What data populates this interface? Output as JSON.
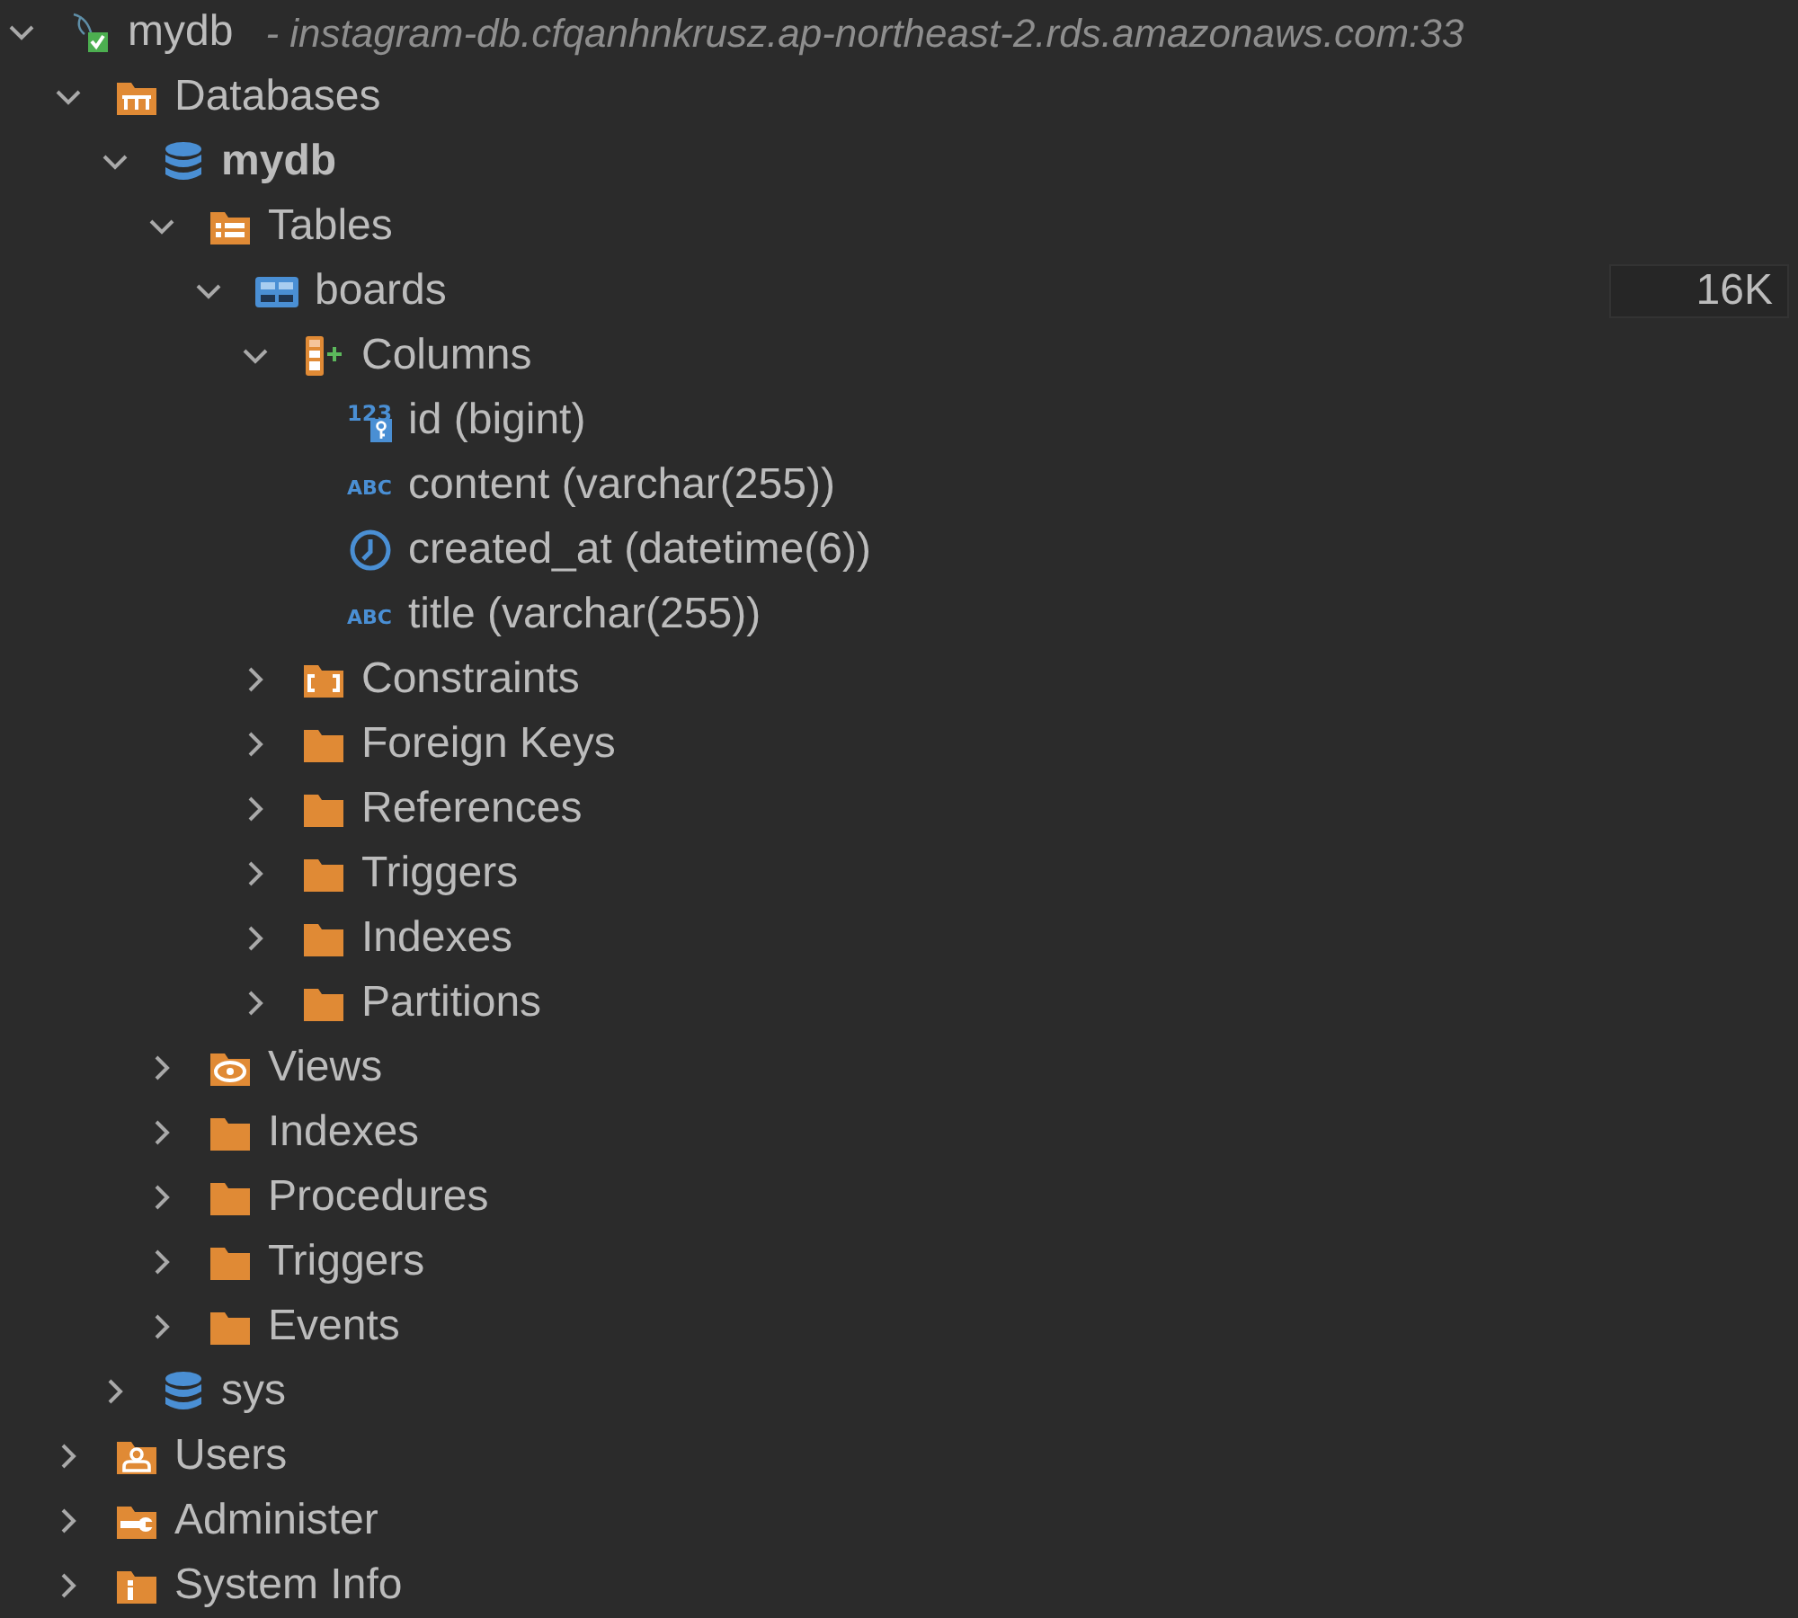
{
  "tree": [
    {
      "kind": "connection",
      "label": "mydb",
      "detail": "- instagram-db.cfqanhnkrusz.ap-northeast-2.rds.amazonaws.com:33",
      "expanded": true,
      "children": [
        {
          "kind": "databases",
          "label": "Databases",
          "expanded": true,
          "children": [
            {
              "kind": "database",
              "label": "mydb",
              "bold": true,
              "expanded": true,
              "children": [
                {
                  "kind": "tables",
                  "label": "Tables",
                  "expanded": true,
                  "children": [
                    {
                      "kind": "table",
                      "label": "boards",
                      "size": "16K",
                      "expanded": true,
                      "children": [
                        {
                          "kind": "columns",
                          "label": "Columns",
                          "expanded": true,
                          "children": [
                            {
                              "kind": "number-key",
                              "icon_text": "123",
                              "label": "id (bigint)"
                            },
                            {
                              "kind": "text-type",
                              "icon_text": "ABC",
                              "label": "content (varchar(255))"
                            },
                            {
                              "kind": "datetime",
                              "label": "created_at (datetime(6))"
                            },
                            {
                              "kind": "text-type",
                              "icon_text": "ABC",
                              "label": "title (varchar(255))"
                            }
                          ]
                        },
                        {
                          "kind": "constraints",
                          "label": "Constraints",
                          "expanded": false
                        },
                        {
                          "kind": "folder",
                          "label": "Foreign Keys",
                          "expanded": false
                        },
                        {
                          "kind": "folder",
                          "label": "References",
                          "expanded": false
                        },
                        {
                          "kind": "folder",
                          "label": "Triggers",
                          "expanded": false
                        },
                        {
                          "kind": "folder",
                          "label": "Indexes",
                          "expanded": false
                        },
                        {
                          "kind": "folder",
                          "label": "Partitions",
                          "expanded": false
                        }
                      ]
                    }
                  ]
                },
                {
                  "kind": "views",
                  "label": "Views",
                  "expanded": false
                },
                {
                  "kind": "folder",
                  "label": "Indexes",
                  "expanded": false
                },
                {
                  "kind": "folder",
                  "label": "Procedures",
                  "expanded": false
                },
                {
                  "kind": "folder",
                  "label": "Triggers",
                  "expanded": false
                },
                {
                  "kind": "folder",
                  "label": "Events",
                  "expanded": false
                }
              ]
            },
            {
              "kind": "database",
              "label": "sys",
              "bold": false,
              "expanded": false
            }
          ]
        },
        {
          "kind": "users",
          "label": "Users",
          "expanded": false
        },
        {
          "kind": "administer",
          "label": "Administer",
          "expanded": false
        },
        {
          "kind": "info",
          "label": "System Info",
          "expanded": false
        }
      ]
    }
  ]
}
